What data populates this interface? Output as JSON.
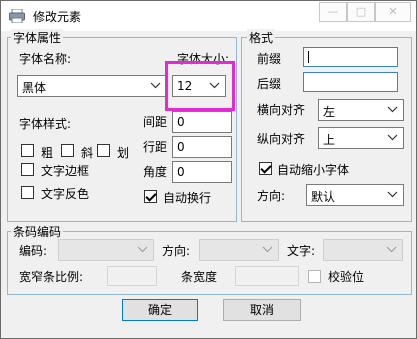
{
  "window": {
    "title": "修改元素",
    "min_glyph": "—",
    "max_glyph": "□",
    "close_glyph": "✕"
  },
  "font_group": {
    "title": "字体属性",
    "font_name_label": "字体名称:",
    "font_size_label": "字体大小:",
    "font_name_value": "黑体",
    "font_size_value": "12",
    "font_style_label": "字体样式:",
    "bold_label": "粗",
    "italic_label": "斜",
    "underline_label": "划",
    "border_label": "文字边框",
    "reverse_label": "文字反色",
    "spacing_label": "间距",
    "line_spacing_label": "行距",
    "angle_label": "角度",
    "spacing_value": "0",
    "line_spacing_value": "0",
    "angle_value": "0",
    "auto_wrap_label": "自动换行"
  },
  "format_group": {
    "title": "格式",
    "prefix_label": "前缀",
    "suffix_label": "后缀",
    "prefix_value": "",
    "suffix_value": "",
    "halign_label": "横向对齐",
    "halign_value": "左",
    "valign_label": "纵向对齐",
    "valign_value": "上",
    "autoshrink_label": "自动缩小字体",
    "direction_label": "方向:",
    "direction_value": "默认"
  },
  "barcode_group": {
    "title": "条码编码",
    "encoding_label": "编码:",
    "direction_label": "方向:",
    "text_label": "文字:",
    "wide_narrow_label": "宽窄条比例:",
    "bar_width_label": "条宽度",
    "check_digit_label": "校验位"
  },
  "buttons": {
    "ok_label": "确定",
    "cancel_label": "取消"
  },
  "states": {
    "bold": false,
    "italic": false,
    "underline": false,
    "border": false,
    "reverse": false,
    "auto_wrap": true,
    "autoshrink": true,
    "check_digit": false
  },
  "icons": [
    "printer-icon",
    "chevron-down-icon"
  ],
  "colors": {
    "highlight": "#e42ad6",
    "groupbox_border": "#8fb7d6",
    "focus_border": "#3c82c8"
  }
}
